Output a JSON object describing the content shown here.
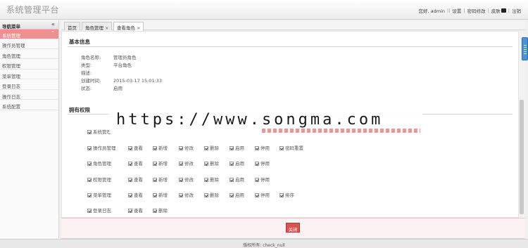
{
  "header": {
    "app_title": "系统管理平台",
    "greeting": "您好, admin",
    "links": [
      "设置",
      "密码修改",
      "皮肤",
      "注销"
    ]
  },
  "sidebar": {
    "title": "导航菜单",
    "group": "系统管理",
    "items": [
      "操作员管理",
      "角色管理",
      "权限管理",
      "菜单管理",
      "登录日志",
      "操作日志",
      "系统配置"
    ]
  },
  "tabs": [
    {
      "label": "首页",
      "closable": false,
      "active": false
    },
    {
      "label": "角色管理",
      "closable": true,
      "active": false
    },
    {
      "label": "查看角色",
      "closable": true,
      "active": true
    }
  ],
  "basic_info": {
    "title": "基本信息",
    "fields": [
      {
        "label": "角色名称:",
        "value": "管理员角色"
      },
      {
        "label": "类型:",
        "value": "平台角色"
      },
      {
        "label": "描述:",
        "value": ""
      },
      {
        "label": "创建时间:",
        "value": "2015-03-17 15:01:33"
      },
      {
        "label": "状态:",
        "value": "启用"
      }
    ]
  },
  "permissions": {
    "title": "拥有权限",
    "root": "系统管理",
    "rows": [
      {
        "module": "操作员管理",
        "actions": [
          "查看",
          "新增",
          "修改",
          "删除",
          "启用",
          "停用",
          "密码重置"
        ]
      },
      {
        "module": "角色管理",
        "actions": [
          "查看",
          "新增",
          "修改",
          "删除",
          "启用",
          "停用"
        ]
      },
      {
        "module": "权限管理",
        "actions": [
          "查看",
          "新增",
          "修改",
          "删除",
          "启用",
          "停用"
        ]
      },
      {
        "module": "菜单管理",
        "actions": [
          "查看",
          "新增",
          "修改",
          "删除",
          "启用",
          "停用",
          "排序"
        ]
      },
      {
        "module": "登录日志",
        "actions": [
          "查看",
          "删除"
        ]
      }
    ]
  },
  "watermark": "https://www.songma.com",
  "close_label": "关闭",
  "footer_text": "版权所有: check_null",
  "colors": {
    "accent": "#f08f8f",
    "close_button": "#d9534f"
  }
}
